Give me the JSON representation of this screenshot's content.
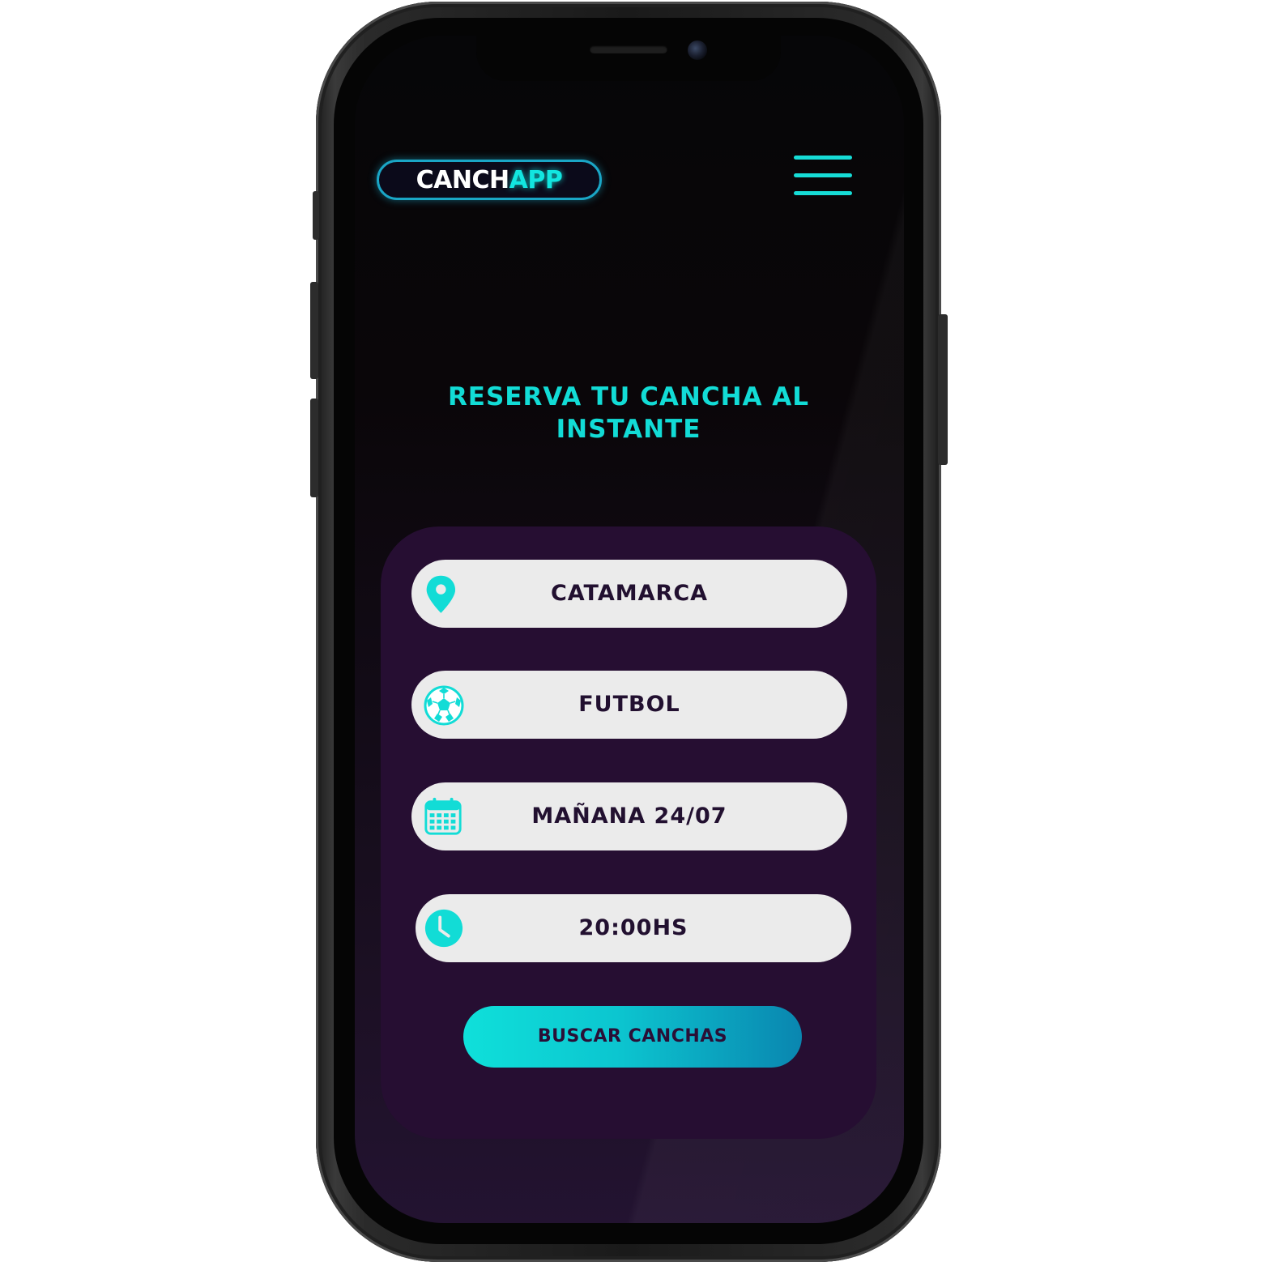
{
  "logo": {
    "part1": "CANCH",
    "part2": "APP"
  },
  "header": {
    "menu_icon": "hamburger-menu-icon"
  },
  "hero": {
    "title": "RESERVA TU CANCHA AL INSTANTE"
  },
  "form": {
    "location": {
      "value": "CATAMARCA",
      "icon": "location-pin-icon"
    },
    "sport": {
      "value": "FUTBOL",
      "icon": "soccer-ball-icon"
    },
    "date": {
      "value": "MAÑANA 24/07",
      "icon": "calendar-icon"
    },
    "time": {
      "value": "20:00HS",
      "icon": "clock-icon"
    },
    "submit_label": "BUSCAR CANCHAS"
  },
  "colors": {
    "accent": "#12dcd6",
    "card_bg": "#260e32",
    "pill_bg": "#ebebeb",
    "text_dark": "#221030"
  }
}
